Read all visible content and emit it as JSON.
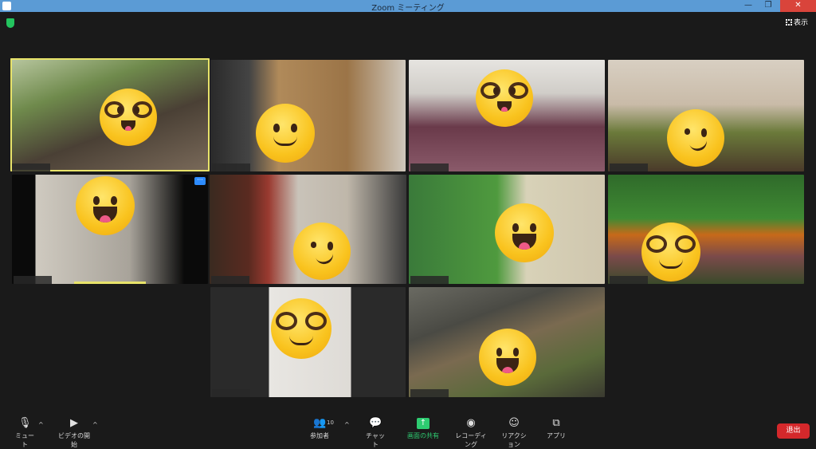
{
  "window": {
    "title": "Zoom ミーティング",
    "min_symbol": "—",
    "max_symbol": "❐",
    "close_symbol": "✕"
  },
  "header": {
    "view_label": "表示"
  },
  "colors": {
    "active_speaker": "#e8e36a",
    "share_green": "#2ecc71",
    "leave_red": "#d4282b",
    "toolbar_bg": "#1a1a1a"
  },
  "toolbar": {
    "mute_label": "ミュート",
    "video_label": "ビデオの開始",
    "participants_label": "参加者",
    "participants_count": "10",
    "chat_label": "チャット",
    "share_label": "画面の共有",
    "record_label": "レコーディング",
    "reactions_label": "リアクション",
    "apps_label": "アプリ",
    "leave_label": "退出"
  },
  "icons": {
    "mute": "microphone-icon",
    "video": "video-camera-icon",
    "participants": "people-icon",
    "chat": "chat-bubble-icon",
    "share": "share-screen-icon",
    "record": "record-icon",
    "reactions": "emoji-plus-icon",
    "apps": "apps-icon",
    "security": "shield-icon",
    "view": "grid-icon"
  },
  "tiles": [
    {
      "id": 1,
      "active": true,
      "emoji": "glasses-grin"
    },
    {
      "id": 2,
      "active": false,
      "emoji": "smile"
    },
    {
      "id": 3,
      "active": false,
      "emoji": "glasses-grin"
    },
    {
      "id": 4,
      "active": false,
      "emoji": "smirk"
    },
    {
      "id": 5,
      "active": false,
      "emoji": "grin"
    },
    {
      "id": 6,
      "active": false,
      "emoji": "smirk"
    },
    {
      "id": 7,
      "active": false,
      "emoji": "grin"
    },
    {
      "id": 8,
      "active": false,
      "emoji": "glasses-smile"
    },
    {
      "id": 9,
      "active": false,
      "emoji": "glasses-smile"
    },
    {
      "id": 10,
      "active": false,
      "emoji": "grin"
    }
  ]
}
